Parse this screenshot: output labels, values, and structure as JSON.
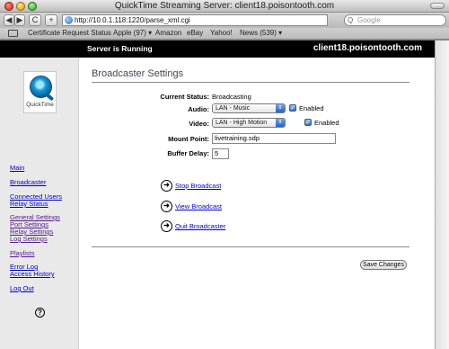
{
  "window": {
    "title": "QuickTime Streaming Server: client18.poisontooth.com"
  },
  "toolbar": {
    "back_glyph": "◀",
    "forward_glyph": "▶",
    "reload_glyph": "C",
    "add_glyph": "+",
    "url": "http://10.0.1.118:1220/parse_xml.cgi",
    "search_placeholder": "Google",
    "search_glyph": "Q"
  },
  "bookmarks": {
    "items": [
      "Certificate Request Status",
      "Apple (97) ▾",
      "Amazon",
      "eBay",
      "Yahoo!",
      "News (539) ▾"
    ]
  },
  "banner": {
    "status": "Server is Running",
    "host": "client18.poisontooth.com"
  },
  "sidebar": {
    "logo_text": "QuickTime",
    "nav": [
      "Main",
      "Broadcaster",
      "Connected Users",
      "Relay Status",
      "General Settings",
      "Port Settings",
      "Relay Settings",
      "Log Settings",
      "Playlists",
      "Error Log",
      "Access History",
      "Log Out"
    ],
    "help_glyph": "?"
  },
  "main": {
    "heading": "Broadcaster Settings",
    "current_status_label": "Current Status:",
    "current_status_value": "Broadcasting",
    "audio_label": "Audio:",
    "audio_value": "LAN - Music",
    "audio_enabled_label": "Enabled",
    "audio_enabled": true,
    "video_label": "Video:",
    "video_value": "LAN - High Motion",
    "video_enabled_label": "Enabled",
    "video_enabled": true,
    "mount_point_label": "Mount Point:",
    "mount_point_value": "livetraining.sdp",
    "buffer_delay_label": "Buffer Delay:",
    "buffer_delay_value": "5",
    "actions": [
      "Stop Broadcast",
      "View Broadcast",
      "Quit Broadcaster"
    ],
    "save_label": "Save Changes"
  },
  "icons": {
    "action_arrow": "arrow-right-circle-icon",
    "help": "help-circle-icon"
  }
}
